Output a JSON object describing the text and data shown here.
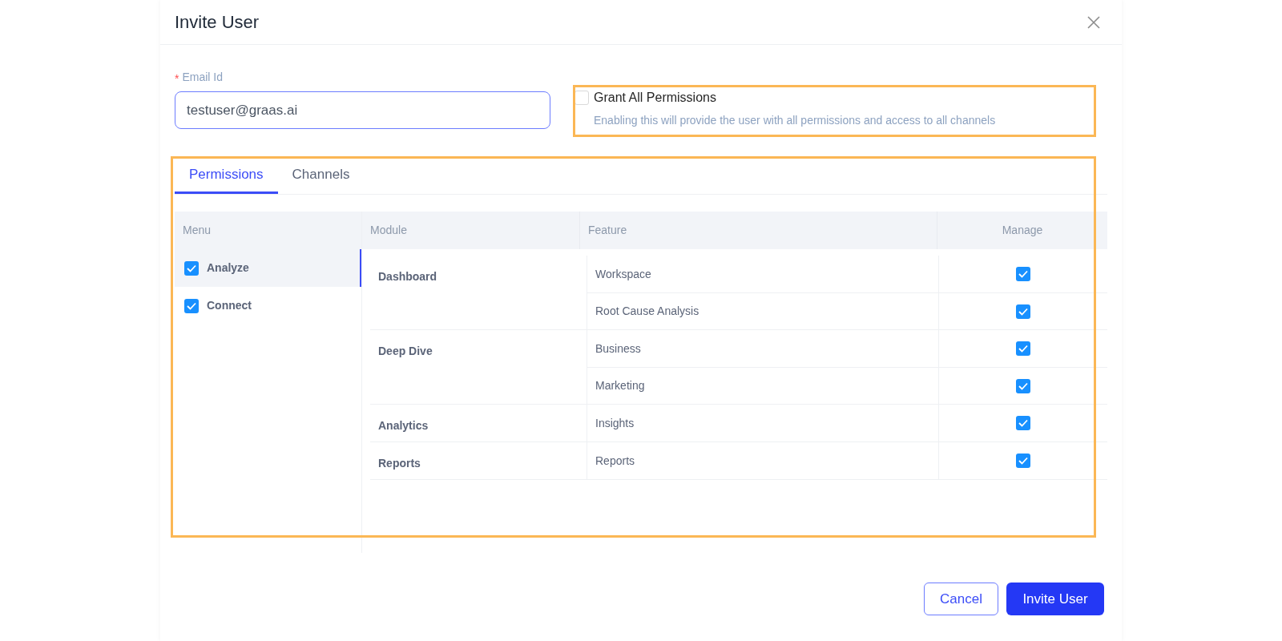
{
  "dialog": {
    "title": "Invite User"
  },
  "email": {
    "required_mark": "*",
    "label": "Email Id",
    "value": "testuser@graas.ai"
  },
  "grant_all": {
    "label": "Grant All Permissions",
    "checked": false,
    "description": "Enabling this will provide the user with all permissions and access to all channels"
  },
  "tabs": [
    {
      "label": "Permissions",
      "selected": true
    },
    {
      "label": "Channels",
      "selected": false
    }
  ],
  "table": {
    "columns": [
      "Menu",
      "Module",
      "Feature",
      "Manage"
    ],
    "menu": [
      {
        "label": "Analyze",
        "checked": true,
        "selected": true
      },
      {
        "label": "Connect",
        "checked": true,
        "selected": false
      }
    ],
    "modules": [
      {
        "name": "Dashboard",
        "features": [
          {
            "name": "Workspace",
            "manage": true
          },
          {
            "name": "Root Cause Analysis",
            "manage": true
          }
        ]
      },
      {
        "name": "Deep Dive",
        "features": [
          {
            "name": "Business",
            "manage": true
          },
          {
            "name": "Marketing",
            "manage": true
          }
        ]
      },
      {
        "name": "Analytics",
        "features": [
          {
            "name": "Insights",
            "manage": true
          }
        ]
      },
      {
        "name": "Reports",
        "features": [
          {
            "name": "Reports",
            "manage": true
          }
        ]
      }
    ]
  },
  "buttons": [
    {
      "label": "Cancel",
      "kind": "secondary"
    },
    {
      "label": "Invite User",
      "kind": "primary"
    }
  ]
}
